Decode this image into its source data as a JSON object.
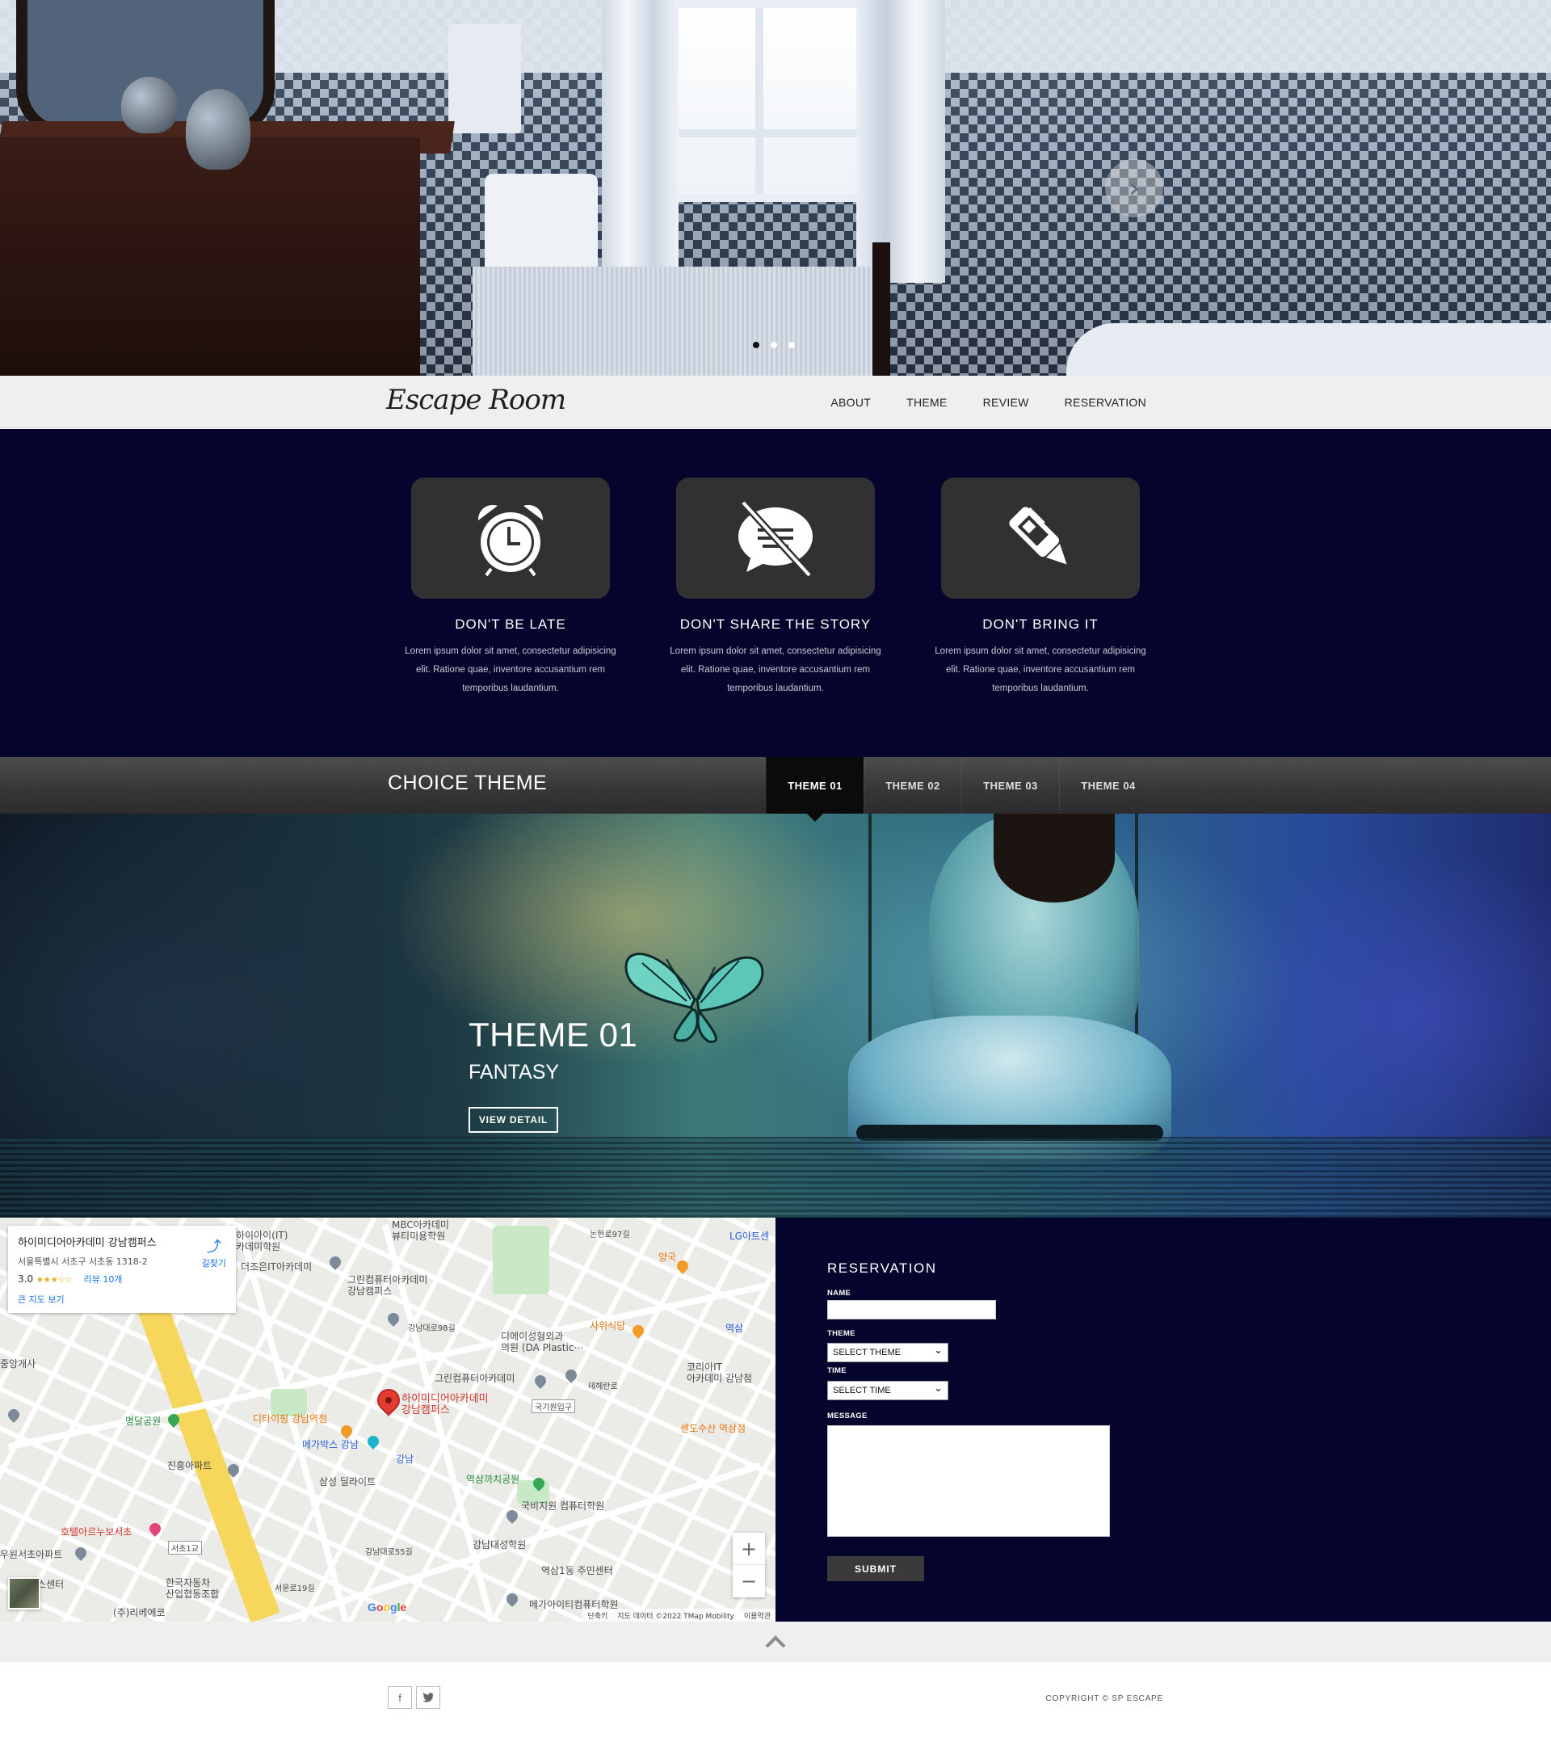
{
  "nav": {
    "logo": "Escape Room",
    "items": [
      "ABOUT",
      "THEME",
      "REVIEW",
      "RESERVATION"
    ]
  },
  "hero": {
    "slides": 3,
    "active_slide": 1,
    "next_icon": "chevron-right-icon"
  },
  "rules": [
    {
      "icon": "alarm-clock-icon",
      "title": "DON'T BE LATE",
      "text": "Lorem ipsum dolor sit amet, consectetur adipisicing elit. Ratione quae, inventore accusantium rem temporibus laudantium."
    },
    {
      "icon": "no-talking-icon",
      "title": "DON'T SHARE THE STORY",
      "text": "Lorem ipsum dolor sit amet, consectetur adipisicing elit. Ratione quae, inventore accusantium rem temporibus laudantium."
    },
    {
      "icon": "pen-icon",
      "title": "DON'T BRING IT",
      "text": "Lorem ipsum dolor sit amet, consectetur adipisicing elit. Ratione quae, inventore accusantium rem temporibus laudantium."
    }
  ],
  "themes": {
    "title": "CHOICE THEME",
    "tabs": [
      "THEME 01",
      "THEME 02",
      "THEME 03",
      "THEME 04"
    ],
    "active_tab": 0,
    "current": {
      "name": "THEME 01",
      "genre": "FANTASY",
      "button": "VIEW DETAIL"
    }
  },
  "map": {
    "place_name": "하이미디어아카데미 강남캠퍼스",
    "address": "서울특별시 서초구 서초동 1318-2",
    "rating": "3.0",
    "stars": "★★★☆☆",
    "reviews": "리뷰 10개",
    "large_map": "큰 지도 보기",
    "directions": "길찾기",
    "marker_label": "하이미디어아카데미\n강남캠퍼스",
    "labels": [
      {
        "text": "MBC아카데미\n뷰티미용학원",
        "color": "default"
      },
      {
        "text": "하이아이(IT)\n카데미학원",
        "color": "default"
      },
      {
        "text": "더조은IT아카데미",
        "color": "default"
      },
      {
        "text": "그린컴퓨터아카데미\n강남캠퍼스",
        "color": "default"
      },
      {
        "text": "양국",
        "color": "orange"
      },
      {
        "text": "LG아트센",
        "color": "blue"
      },
      {
        "text": "사위식당",
        "color": "orange"
      },
      {
        "text": "역삼",
        "color": "blue"
      },
      {
        "text": "디에이성형외과\n의원 (DA Plastic⋯",
        "color": "default"
      },
      {
        "text": "그린컴퓨터아카데미",
        "color": "default"
      },
      {
        "text": "코리아IT\n아카데미 강남점",
        "color": "default"
      },
      {
        "text": "센도수산 역삼점",
        "color": "orange"
      },
      {
        "text": "중앙개사",
        "color": "default"
      },
      {
        "text": "명달공원",
        "color": "green"
      },
      {
        "text": "디타이핑 강남역점",
        "color": "orange"
      },
      {
        "text": "메가박스 강남",
        "color": "blue"
      },
      {
        "text": "강남",
        "color": "blue"
      },
      {
        "text": "국기원입구",
        "color": "default"
      },
      {
        "text": "진흥아파트",
        "color": "default"
      },
      {
        "text": "삼성 딜라이트",
        "color": "default"
      },
      {
        "text": "역삼까치공원",
        "color": "green"
      },
      {
        "text": "국비지원 컴퓨터학원",
        "color": "default"
      },
      {
        "text": "호텔아르누보서초",
        "color": "red"
      },
      {
        "text": "서초1교",
        "color": "default"
      },
      {
        "text": "우원서초아파트",
        "color": "default"
      },
      {
        "text": "강남대성학원",
        "color": "default"
      },
      {
        "text": "역삼1동 주민센터",
        "color": "default"
      },
      {
        "text": "비스센터",
        "color": "default"
      },
      {
        "text": "한국자동차\n산업협동조합",
        "color": "default"
      },
      {
        "text": "메가아이티컴퓨터학원",
        "color": "default"
      },
      {
        "text": "(주)리베에코",
        "color": "default"
      },
      {
        "text": "강남대로98길",
        "color": "default"
      },
      {
        "text": "테헤란로",
        "color": "default"
      },
      {
        "text": "논현로97길",
        "color": "default"
      },
      {
        "text": "강남대로55길",
        "color": "default"
      },
      {
        "text": "서운로19길",
        "color": "default"
      }
    ],
    "zoom_in": "+",
    "zoom_out": "−",
    "google": "Google",
    "attribution": [
      "단축키",
      "지도 데이터 ©2022 TMap Mobility",
      "이용약관"
    ]
  },
  "reservation": {
    "title": "RESERVATION",
    "name_label": "NAME",
    "theme_label": "THEME",
    "theme_value": "SELECT THEME",
    "time_label": "TIME",
    "time_value": "SELECT TIME",
    "message_label": "MESSAGE",
    "submit": "SUBMIT"
  },
  "footer": {
    "social": [
      "f",
      "t"
    ],
    "copyright": "COPYRIGHT © SP ESCAPE",
    "to_top_icon": "chevron-up-icon"
  }
}
